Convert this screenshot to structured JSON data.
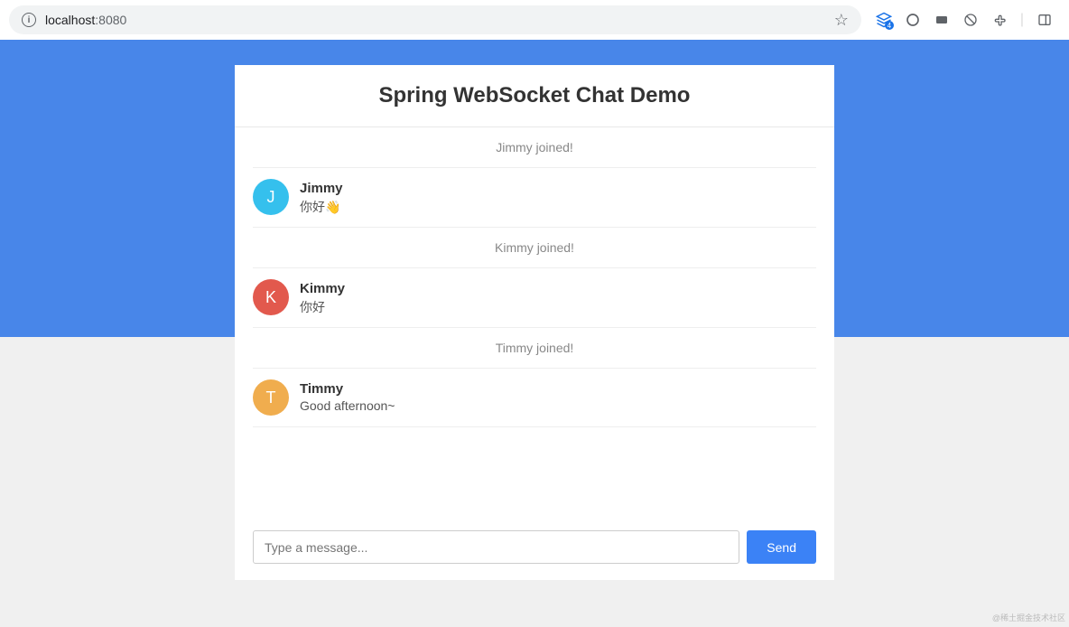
{
  "browser": {
    "url_host": "localhost",
    "url_port": ":8080",
    "dev_badge": "4"
  },
  "chat": {
    "title": "Spring WebSocket Chat Demo",
    "messages": [
      {
        "type": "event",
        "text": "Jimmy joined!"
      },
      {
        "type": "chat",
        "sender": "Jimmy",
        "initial": "J",
        "color": "#35c0ed",
        "text": "你好👋"
      },
      {
        "type": "event",
        "text": "Kimmy joined!"
      },
      {
        "type": "chat",
        "sender": "Kimmy",
        "initial": "K",
        "color": "#e2594d",
        "text": "你好"
      },
      {
        "type": "event",
        "text": "Timmy joined!"
      },
      {
        "type": "chat",
        "sender": "Timmy",
        "initial": "T",
        "color": "#f0ad4e",
        "text": "Good afternoon~"
      }
    ],
    "input_placeholder": "Type a message...",
    "send_label": "Send"
  },
  "watermark": "@稀土掘金技术社区"
}
